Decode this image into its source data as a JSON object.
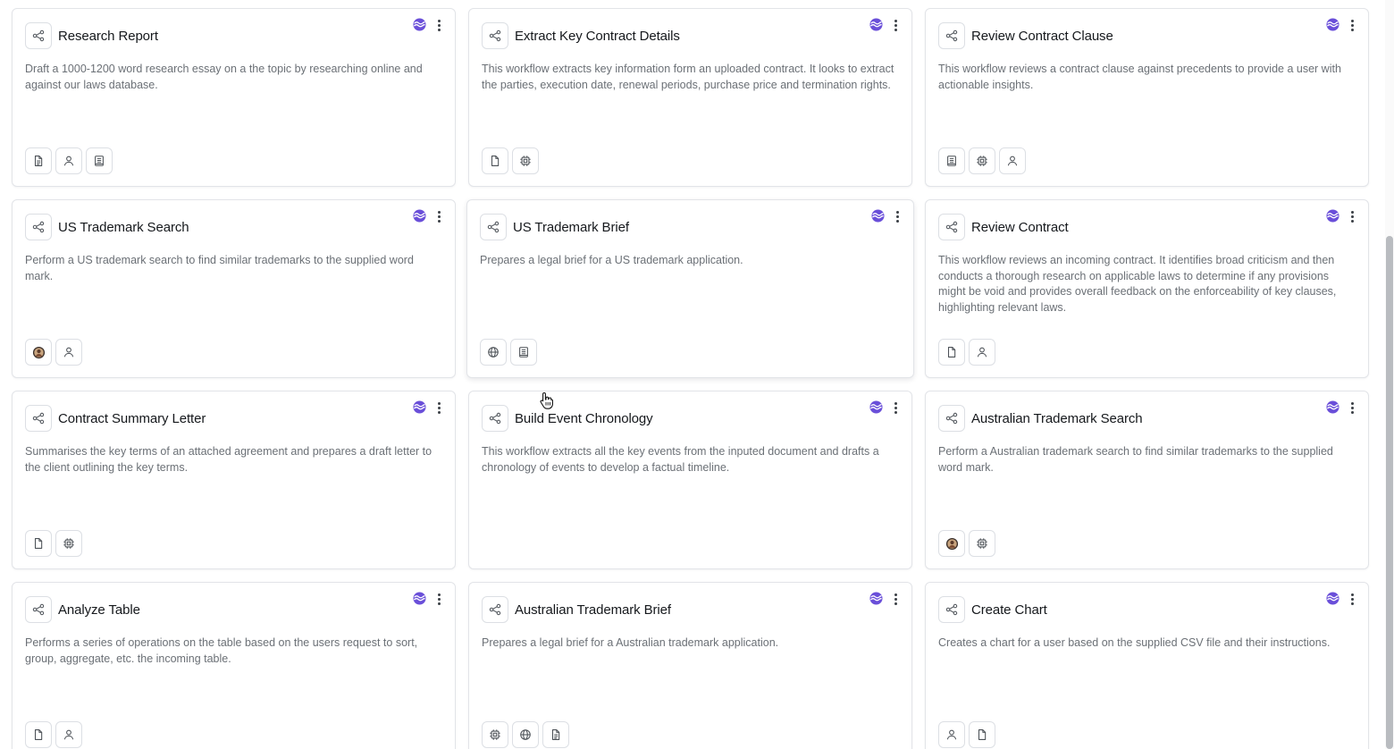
{
  "colors": {
    "brand_purple": "#6a4fd9",
    "card_border": "#e2e4e8",
    "description_text": "#6b7076",
    "title_text": "#15181c"
  },
  "cards": [
    {
      "title": "Research Report",
      "description": "Draft a 1000-1200 word research essay on a the topic by researching online and against our laws database.",
      "tools": [
        "document-lines-icon",
        "user-icon",
        "notebook-icon"
      ]
    },
    {
      "title": "Extract Key Contract Details",
      "description": "This workflow extracts key information form an uploaded contract. It looks to extract the parties, execution date, renewal periods, purchase price and termination rights.",
      "tools": [
        "file-icon",
        "chip-icon"
      ]
    },
    {
      "title": "Review Contract Clause",
      "description": "This workflow reviews a contract clause against precedents to provide a user with actionable insights.",
      "tools": [
        "notebook-icon",
        "chip-icon",
        "user-icon"
      ]
    },
    {
      "title": "US Trademark Search",
      "description": "Perform a US trademark search to find similar trademarks to the supplied word mark.",
      "tools": [
        "avatar-icon",
        "user-icon"
      ]
    },
    {
      "title": "US Trademark Brief",
      "description": "Prepares a legal brief for a US trademark application.",
      "tools": [
        "globe-icon",
        "notebook-icon"
      ]
    },
    {
      "title": "Review Contract",
      "description": "This workflow reviews an incoming contract. It identifies broad criticism and then conducts a thorough research on applicable laws to determine if any provisions might be void and provides overall feedback on the enforceability of key clauses, highlighting relevant laws.",
      "tools": [
        "file-icon",
        "user-icon"
      ]
    },
    {
      "title": "Contract Summary Letter",
      "description": "Summarises the key terms of an attached agreement and prepares a draft letter to the client outlining the key terms.",
      "tools": [
        "file-icon",
        "chip-icon"
      ]
    },
    {
      "title": "Build Event Chronology",
      "description": "This workflow extracts all the key events from the inputed document and drafts a chronology of events to develop a factual timeline.",
      "tools": []
    },
    {
      "title": "Australian Trademark Search",
      "description": "Perform a Australian trademark search to find similar trademarks to the supplied word mark.",
      "tools": [
        "avatar-icon",
        "chip-icon"
      ]
    },
    {
      "title": "Analyze Table",
      "description": "Performs a series of operations on the table based on the users request to sort, group, aggregate, etc. the incoming table.",
      "tools": [
        "file-icon",
        "user-icon"
      ]
    },
    {
      "title": "Australian Trademark Brief",
      "description": "Prepares a legal brief for a Australian trademark application.",
      "tools": [
        "chip-icon",
        "globe-icon",
        "document-lines-icon"
      ]
    },
    {
      "title": "Create Chart",
      "description": "Creates a chart for a user based on the supplied CSV file and their instructions.",
      "tools": [
        "user-icon",
        "file-icon"
      ]
    }
  ]
}
